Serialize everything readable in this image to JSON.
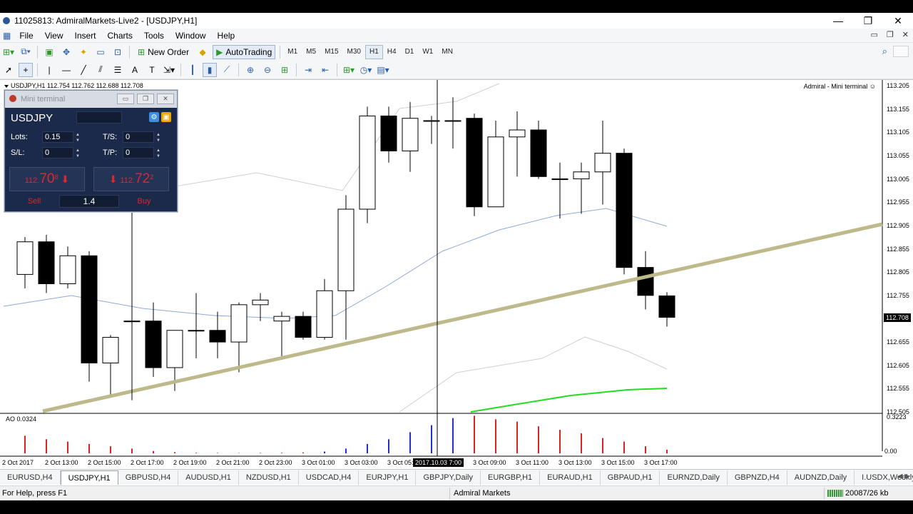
{
  "window": {
    "title": "11025813: AdmiralMarkets-Live2 - [USDJPY,H1]",
    "controls": [
      "—",
      "❐",
      "✕"
    ]
  },
  "menu": [
    "File",
    "View",
    "Insert",
    "Charts",
    "Tools",
    "Window",
    "Help"
  ],
  "toolbar": {
    "new_order": "New Order",
    "auto_trading": "AutoTrading",
    "timeframes": [
      "M1",
      "M5",
      "M15",
      "M30",
      "H1",
      "H4",
      "D1",
      "W1",
      "MN"
    ],
    "active_timeframe": "H1"
  },
  "chart": {
    "header": "USDJPY,H1  112.754 112.762 112.688 112.708",
    "ea_label": "Admiral - Mini terminal ☺",
    "current_price": "112.708",
    "crosshair_time": "2017.10.03 7:00",
    "ao_label": "AO 0.0324",
    "ao_value": "0.3223",
    "ao_zero": "0.00",
    "y_labels": [
      "113.205",
      "113.155",
      "113.105",
      "113.055",
      "113.005",
      "112.955",
      "112.905",
      "112.855",
      "112.805",
      "112.755",
      "112.705",
      "112.655",
      "112.605",
      "112.555",
      "112.505"
    ],
    "x_labels": [
      "2 Oct 2017",
      "2 Oct 13:00",
      "2 Oct 15:00",
      "2 Oct 17:00",
      "2 Oct 19:00",
      "2 Oct 21:00",
      "2 Oct 23:00",
      "3 Oct 01:00",
      "3 Oct 03:00",
      "3 Oct 05:00",
      "3 Oct 09:00",
      "3 Oct 11:00",
      "3 Oct 13:00",
      "3 Oct 15:00",
      "3 Oct 17:00"
    ],
    "colors": {
      "up": "#ffffff",
      "down": "#000000",
      "ma": "#8ea9d8",
      "trendline": "#bdb98a",
      "green_ma": "#22dd22",
      "ao_up": "#2233cc",
      "ao_down": "#dd2222"
    }
  },
  "chart_data": {
    "type": "candlestick",
    "symbol": "USDJPY",
    "timeframe": "H1",
    "ohlc": [
      {
        "o": 112.8,
        "h": 112.88,
        "l": 112.77,
        "c": 112.87
      },
      {
        "o": 112.87,
        "h": 112.885,
        "l": 112.76,
        "c": 112.78
      },
      {
        "o": 112.78,
        "h": 112.86,
        "l": 112.77,
        "c": 112.84
      },
      {
        "o": 112.84,
        "h": 112.85,
        "l": 112.57,
        "c": 112.61
      },
      {
        "o": 112.61,
        "h": 112.67,
        "l": 112.54,
        "c": 112.665
      },
      {
        "o": 112.7,
        "h": 112.8,
        "l": 112.53,
        "c": 112.7
      },
      {
        "o": 112.7,
        "h": 112.74,
        "l": 112.58,
        "c": 112.6
      },
      {
        "o": 112.6,
        "h": 112.68,
        "l": 112.55,
        "c": 112.68
      },
      {
        "o": 112.68,
        "h": 112.76,
        "l": 112.62,
        "c": 112.68
      },
      {
        "o": 112.68,
        "h": 112.72,
        "l": 112.62,
        "c": 112.655
      },
      {
        "o": 112.655,
        "h": 112.74,
        "l": 112.59,
        "c": 112.735
      },
      {
        "o": 112.735,
        "h": 112.76,
        "l": 112.7,
        "c": 112.745
      },
      {
        "o": 112.7,
        "h": 112.72,
        "l": 112.62,
        "c": 112.71
      },
      {
        "o": 112.71,
        "h": 112.72,
        "l": 112.66,
        "c": 112.665
      },
      {
        "o": 112.665,
        "h": 112.79,
        "l": 112.66,
        "c": 112.765
      },
      {
        "o": 112.765,
        "h": 112.97,
        "l": 112.66,
        "c": 112.94
      },
      {
        "o": 112.94,
        "h": 113.16,
        "l": 112.91,
        "c": 113.14
      },
      {
        "o": 113.14,
        "h": 113.16,
        "l": 113.04,
        "c": 113.065
      },
      {
        "o": 113.065,
        "h": 113.17,
        "l": 113.02,
        "c": 113.135
      },
      {
        "o": 113.13,
        "h": 113.14,
        "l": 113.08,
        "c": 113.13
      },
      {
        "o": 113.13,
        "h": 113.18,
        "l": 113.07,
        "c": 113.13
      },
      {
        "o": 113.135,
        "h": 113.145,
        "l": 112.925,
        "c": 112.945
      },
      {
        "o": 112.945,
        "h": 113.13,
        "l": 112.945,
        "c": 113.095
      },
      {
        "o": 113.095,
        "h": 113.15,
        "l": 113.01,
        "c": 113.11
      },
      {
        "o": 113.11,
        "h": 113.13,
        "l": 113.005,
        "c": 113.01
      },
      {
        "o": 113.005,
        "h": 113.04,
        "l": 112.92,
        "c": 113.005
      },
      {
        "o": 113.005,
        "h": 113.04,
        "l": 112.93,
        "c": 113.02
      },
      {
        "o": 113.02,
        "h": 113.13,
        "l": 112.95,
        "c": 113.06
      },
      {
        "o": 113.06,
        "h": 113.07,
        "l": 112.8,
        "c": 112.815
      },
      {
        "o": 112.815,
        "h": 112.85,
        "l": 112.725,
        "c": 112.755
      },
      {
        "o": 112.754,
        "h": 112.762,
        "l": 112.688,
        "c": 112.708
      }
    ],
    "ao_histogram": [
      0.15,
      0.12,
      0.1,
      0.08,
      0.06,
      0.04,
      0.02,
      0.01,
      0.005,
      0.003,
      0.002,
      0.003,
      0.005,
      0.008,
      0.015,
      0.04,
      0.08,
      0.12,
      0.18,
      0.24,
      0.3,
      0.32,
      0.29,
      0.27,
      0.23,
      0.2,
      0.17,
      0.13,
      0.1,
      0.06,
      0.03
    ],
    "ao_colors": [
      "d",
      "d",
      "d",
      "d",
      "d",
      "d",
      "d",
      "d",
      "d",
      "u",
      "u",
      "u",
      "d",
      "d",
      "u",
      "u",
      "u",
      "u",
      "u",
      "u",
      "u",
      "d",
      "d",
      "d",
      "d",
      "d",
      "d",
      "d",
      "d",
      "d",
      "d"
    ],
    "ylim": [
      112.505,
      113.205
    ]
  },
  "mini_terminal": {
    "title": "Mini terminal",
    "symbol": "USDJPY",
    "lots_label": "Lots:",
    "lots": "0.15",
    "ts_label": "T/S:",
    "ts": "0",
    "sl_label": "S/L:",
    "sl": "0",
    "tp_label": "T/P:",
    "tp": "0",
    "sell_small": "112.",
    "sell_big": "70",
    "sell_sup": "8",
    "buy_small": "112.",
    "buy_big": "72",
    "buy_sup": "2",
    "sell_label": "Sell",
    "buy_label": "Buy",
    "spread": "1.4"
  },
  "tabs": [
    "EURUSD,H4",
    "USDJPY,H1",
    "GBPUSD,H4",
    "AUDUSD,H1",
    "NZDUSD,H1",
    "USDCAD,H4",
    "EURJPY,H1",
    "GBPJPY,Daily",
    "EURGBP,H1",
    "EURAUD,H1",
    "GBPAUD,H1",
    "EURNZD,Daily",
    "GBPNZD,H4",
    "AUDNZD,Daily",
    "I.USDX,Weekly"
  ],
  "active_tab": "USDJPY,H1",
  "status": {
    "help": "For Help, press F1",
    "profile": "Admiral Markets",
    "traffic": "20087/26 kb"
  }
}
